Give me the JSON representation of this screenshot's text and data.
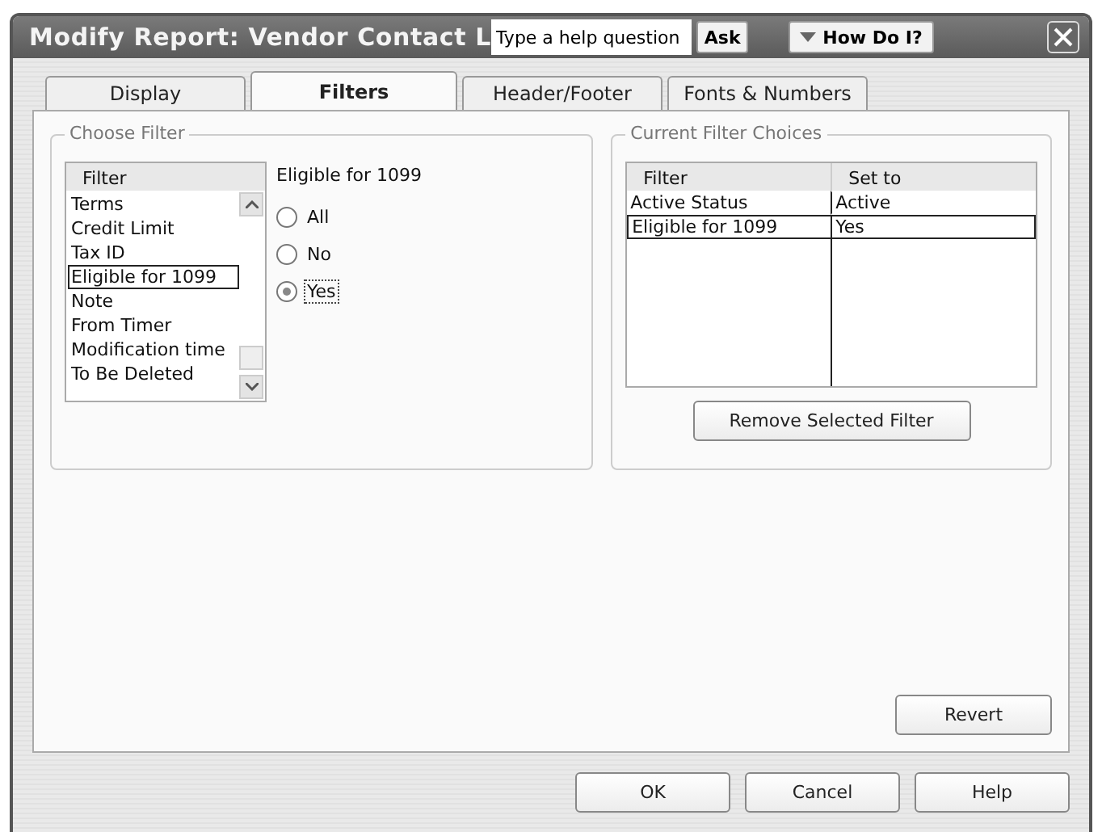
{
  "window": {
    "title": "Modify Report: Vendor Contact L",
    "help_field": {
      "placeholder": "Type a help question"
    },
    "ask_button": "Ask",
    "how_do_i_button": "How Do I?"
  },
  "tabs": [
    {
      "label": "Display",
      "selected": false
    },
    {
      "label": "Filters",
      "selected": true
    },
    {
      "label": "Header/Footer",
      "selected": false
    },
    {
      "label": "Fonts & Numbers",
      "selected": false
    }
  ],
  "choose_filter": {
    "title": "Choose Filter",
    "list_header": "Filter",
    "items": [
      {
        "label": "Terms",
        "selected": false
      },
      {
        "label": "Credit Limit",
        "selected": false
      },
      {
        "label": "Tax ID",
        "selected": false
      },
      {
        "label": "Eligible for 1099",
        "selected": true
      },
      {
        "label": "Note",
        "selected": false
      },
      {
        "label": "From Timer",
        "selected": false
      },
      {
        "label": "Modification time",
        "selected": false
      },
      {
        "label": "To Be Deleted",
        "selected": false
      }
    ],
    "option_title": "Eligible for 1099",
    "options": [
      {
        "label": "All",
        "selected": false
      },
      {
        "label": "No",
        "selected": false
      },
      {
        "label": "Yes",
        "selected": true
      }
    ]
  },
  "current_filters": {
    "title": "Current Filter Choices",
    "columns": [
      "Filter",
      "Set to"
    ],
    "rows": [
      {
        "filter": "Active Status",
        "set_to": "Active",
        "selected": false
      },
      {
        "filter": "Eligible for 1099",
        "set_to": "Yes",
        "selected": true
      }
    ],
    "remove_button": "Remove Selected Filter"
  },
  "revert_button": "Revert",
  "buttons": [
    "OK",
    "Cancel",
    "Help"
  ]
}
